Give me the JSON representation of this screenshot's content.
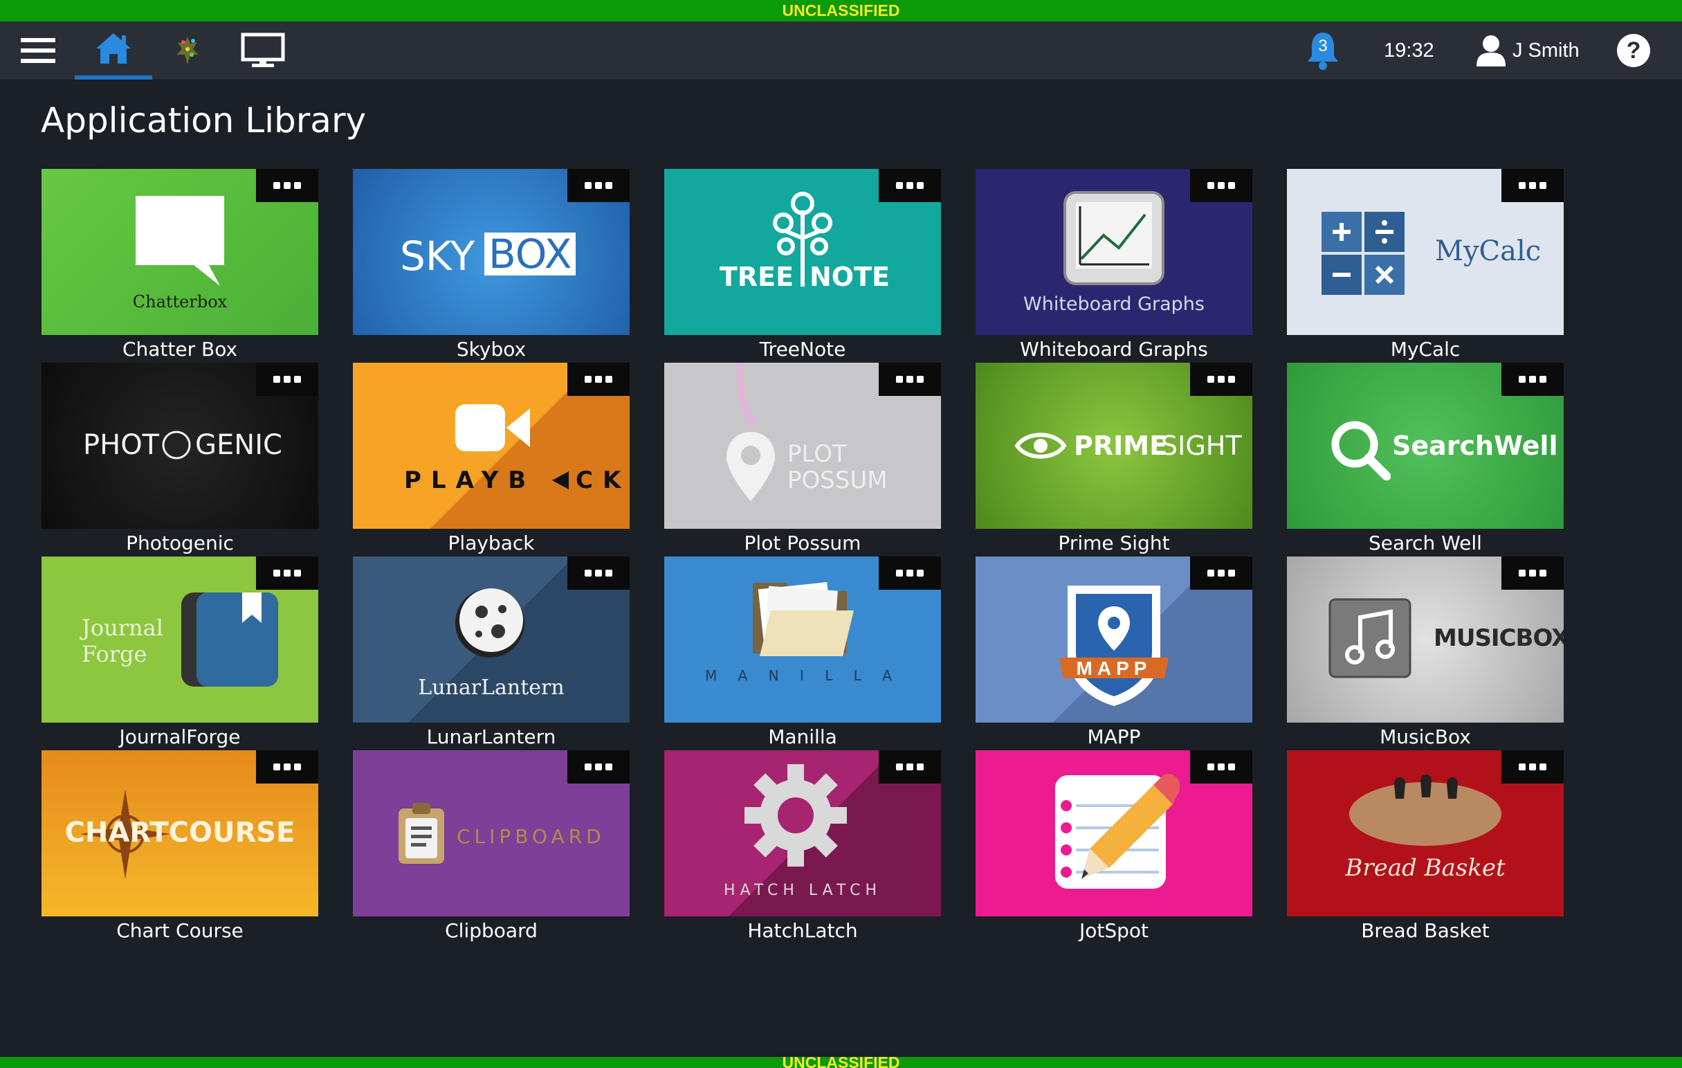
{
  "classification": "UNCLASSIFIED",
  "header": {
    "notification_count": "3",
    "time": "19:32",
    "user_name": "J Smith"
  },
  "page_title": "Application Library",
  "apps": {
    "chatterbox": {
      "label": "Chatter Box",
      "logo": "Chatterbox",
      "color": "#5bbd3e"
    },
    "skybox": {
      "label": "Skybox",
      "logo_a": "SKY",
      "logo_b": "BOX",
      "color": "#2f7fc6"
    },
    "treenote": {
      "label": "TreeNote",
      "logo_a": "TREE",
      "logo_b": "NOTE",
      "color": "#13a89e"
    },
    "whiteboard": {
      "label": "Whiteboard Graphs",
      "logo": "Whiteboard Graphs",
      "color": "#2b2670"
    },
    "mycalc": {
      "label": "MyCalc",
      "logo": "MyCalc",
      "color": "#dfe5ef"
    },
    "photogenic": {
      "label": "Photogenic",
      "logo_a": "PHOT",
      "logo_b": "GENIC",
      "color": "#141414"
    },
    "playback": {
      "label": "Playback",
      "logo_a": "PLAYB",
      "logo_b": "CK",
      "color": "#f49a1e"
    },
    "plotpossum": {
      "label": "Plot Possum",
      "logo_a": "PLOT",
      "logo_b": "POSSUM",
      "color": "#c7c7c9"
    },
    "primesight": {
      "label": "Prime Sight",
      "logo_a": "PRIME",
      "logo_b": "SIGHT",
      "color": "#6fb02a"
    },
    "searchwell": {
      "label": "Search Well",
      "logo": "SearchWell",
      "color": "#3fb048"
    },
    "journalforge": {
      "label": "JournalForge",
      "logo_a": "Journal",
      "logo_b": "Forge",
      "color": "#8dc63f"
    },
    "lunarlantern": {
      "label": "LunarLantern",
      "logo": "LunarLantern",
      "color": "#2c4766"
    },
    "manilla": {
      "label": "Manilla",
      "logo": "M A N I L L A",
      "color": "#3a8ad0"
    },
    "mapp": {
      "label": "MAPP",
      "logo": "MAPP",
      "color": "#6b8ec7"
    },
    "musicbox": {
      "label": "MusicBox",
      "logo": "MUSICBOX",
      "color": "#bdbdbd"
    },
    "chartcourse": {
      "label": "Chart Course",
      "logo": "CHARTCOURSE",
      "color": "#f0a220"
    },
    "clipboard": {
      "label": "Clipboard",
      "logo": "CLIPBOARD",
      "color": "#7d3f98"
    },
    "hatchlatch": {
      "label": "HatchLatch",
      "logo": "HATCH LATCH",
      "color": "#9b2066"
    },
    "jotspot": {
      "label": "JotSpot",
      "color": "#ec1b8f"
    },
    "breadbasket": {
      "label": "Bread Basket",
      "logo": "Bread Basket",
      "color": "#b3111a"
    }
  }
}
